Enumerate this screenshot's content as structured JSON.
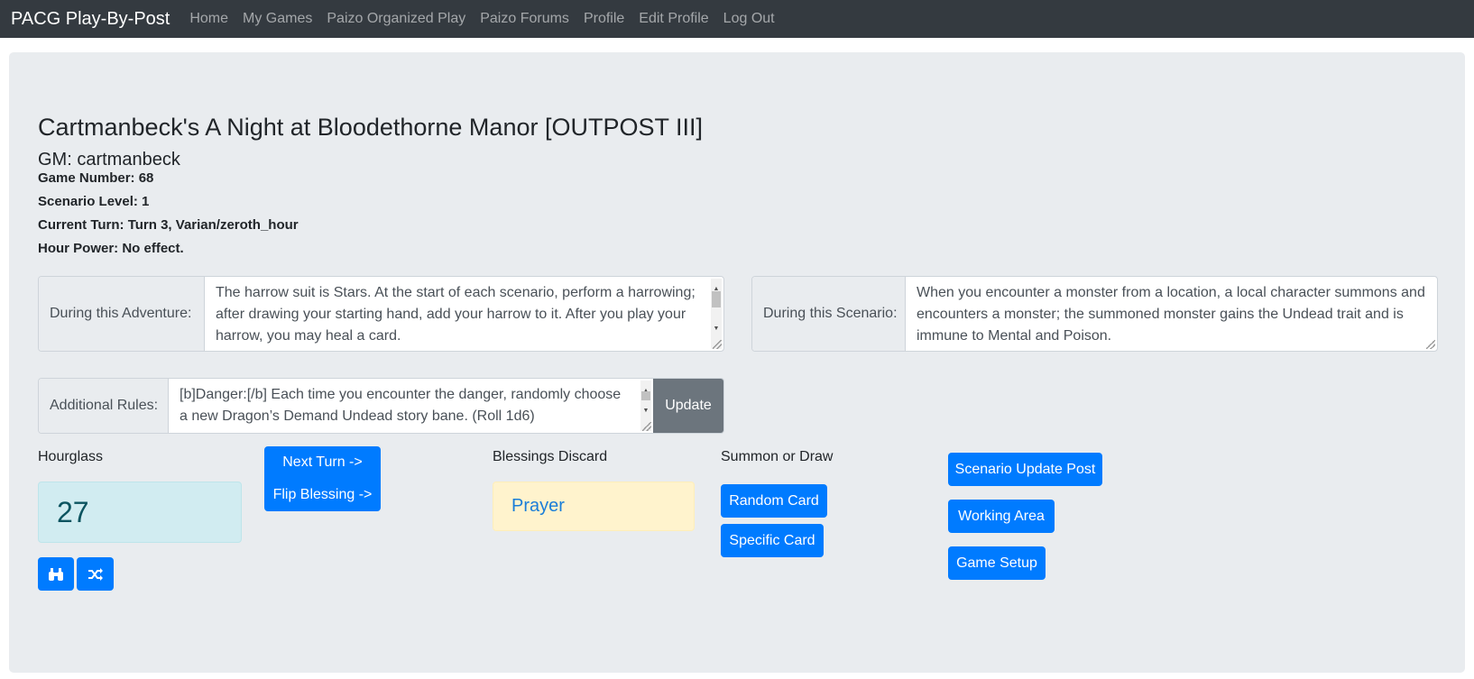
{
  "nav": {
    "brand": "PACG Play-By-Post",
    "links": [
      "Home",
      "My Games",
      "Paizo Organized Play",
      "Paizo Forums",
      "Profile",
      "Edit Profile",
      "Log Out"
    ]
  },
  "game": {
    "title": "Cartmanbeck's A Night at Bloodethorne Manor [OUTPOST III]",
    "gm": "GM: cartmanbeck",
    "game_number": "Game Number: 68",
    "scenario_level": "Scenario Level: 1",
    "current_turn": "Current Turn: Turn 3, Varian/zeroth_hour",
    "hour_power": "Hour Power: No effect."
  },
  "adventure": {
    "label": "During this Adventure:",
    "text": "The harrow suit is Stars. At the start of each scenario, perform a harrowing; after drawing your starting hand, add your harrow to it. After you play your harrow, you may heal a card."
  },
  "scenario": {
    "label": "During this Scenario:",
    "text": "When you encounter a monster from a location, a local character summons and encounters a monster; the summoned monster gains the Undead trait and is immune to Mental and Poison."
  },
  "additional": {
    "label": "Additional Rules:",
    "text": "[b]Danger:[/b] Each time you encounter the danger, randomly choose a new Dragon’s Demand Undead story bane. (Roll 1d6)",
    "update_label": "Update"
  },
  "hourglass": {
    "label": "Hourglass",
    "value": "27",
    "icons": [
      "binoculars-icon",
      "shuffle-icon"
    ]
  },
  "turn": {
    "next_turn": "Next Turn ->",
    "flip_blessing": "Flip Blessing ->"
  },
  "blessings": {
    "label": "Blessings Discard",
    "card": "Prayer"
  },
  "summon": {
    "label": "Summon or Draw",
    "random": "Random Card",
    "specific": "Specific Card"
  },
  "actions": {
    "scenario_update": "Scenario Update Post",
    "working_area": "Working Area",
    "game_setup": "Game Setup"
  },
  "colors": {
    "navbar": "#343a40",
    "jumbotron": "#e9ecef",
    "primary": "#007bff",
    "secondary": "#6c757d",
    "info_bg": "#d1ecf1",
    "warning_bg": "#fff3cd"
  }
}
